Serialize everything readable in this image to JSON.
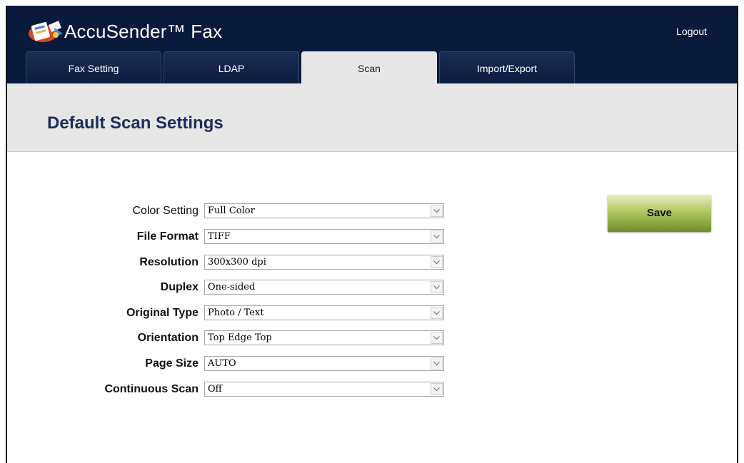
{
  "app": {
    "title": "AccuSender™ Fax",
    "logout_label": "Logout"
  },
  "tabs": [
    {
      "label": "Fax Setting",
      "active": false
    },
    {
      "label": "LDAP",
      "active": false
    },
    {
      "label": "Scan",
      "active": true
    },
    {
      "label": "Import/Export",
      "active": false
    }
  ],
  "page": {
    "title": "Default Scan Settings"
  },
  "settings": [
    {
      "label": "Color Setting",
      "value": "Full Color"
    },
    {
      "label": "File Format",
      "value": "TIFF"
    },
    {
      "label": "Resolution",
      "value": "300x300 dpi"
    },
    {
      "label": "Duplex",
      "value": "One-sided"
    },
    {
      "label": "Original Type",
      "value": "Photo / Text"
    },
    {
      "label": "Orientation",
      "value": "Top Edge Top"
    },
    {
      "label": "Page Size",
      "value": "AUTO"
    },
    {
      "label": "Continuous Scan",
      "value": "Off"
    }
  ],
  "actions": {
    "save_label": "Save"
  },
  "colors": {
    "header": "#0a1a3d",
    "title": "#1a2e5a",
    "band": "#e6e6e6",
    "save_button": "#9cb34a"
  }
}
